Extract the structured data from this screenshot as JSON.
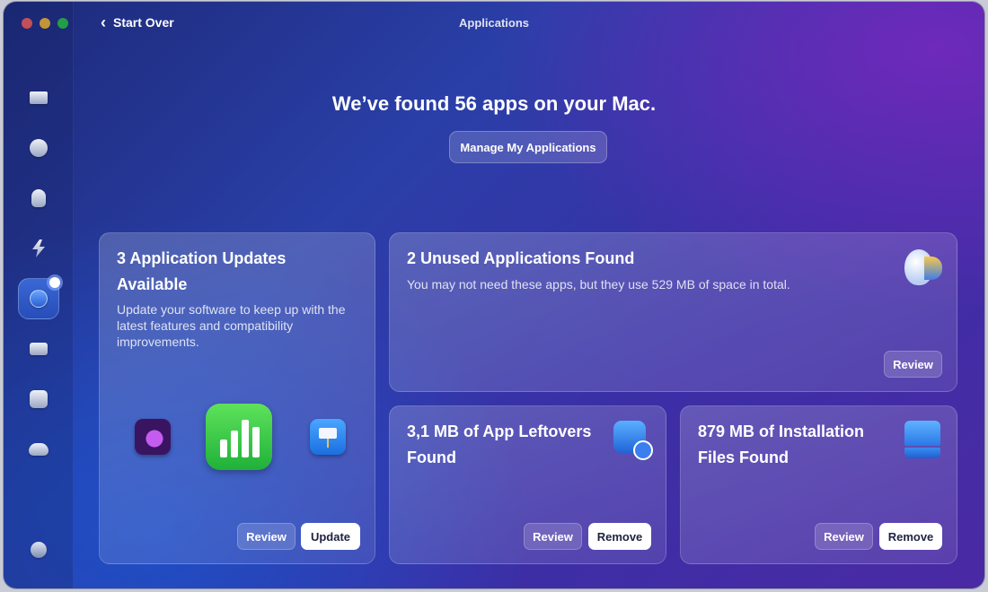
{
  "window": {
    "title": "Applications",
    "back_label": "Start Over"
  },
  "sidebar": {
    "items": [
      {
        "name": "sidebar-item-smart-care",
        "icon": "display-icon",
        "active": false
      },
      {
        "name": "sidebar-item-cleanup",
        "icon": "globe-icon",
        "active": false
      },
      {
        "name": "sidebar-item-protection",
        "icon": "hand-icon",
        "active": false
      },
      {
        "name": "sidebar-item-performance",
        "icon": "bolt-icon",
        "active": false
      },
      {
        "name": "sidebar-item-applications",
        "icon": "app-store-icon",
        "active": true
      },
      {
        "name": "sidebar-item-my-clutter",
        "icon": "folder-icon",
        "active": false
      },
      {
        "name": "sidebar-item-space-lens",
        "icon": "lens-icon",
        "active": false
      },
      {
        "name": "sidebar-item-cloud",
        "icon": "cloud-icon",
        "active": false
      }
    ],
    "account_icon": "avatar-icon"
  },
  "hero": {
    "title": "We’ve found 56 apps on your Mac.",
    "manage_button": "Manage My Applications"
  },
  "cards": {
    "updates": {
      "title": "3 Application Updates Available",
      "description": "Update your software to keep up with the latest features and compatibility improvements.",
      "review_label": "Review",
      "update_label": "Update",
      "apps": [
        "purple-app-icon",
        "numbers-app-icon",
        "keynote-app-icon"
      ]
    },
    "unused": {
      "title": "2 Unused Applications Found",
      "description": "You may not need these apps, but they use 529 MB of space in total.",
      "review_label": "Review",
      "icon": "unused-apps-icon"
    },
    "leftovers": {
      "title": "3,1 MB of App Leftovers Found",
      "review_label": "Review",
      "remove_label": "Remove",
      "icon": "leftovers-icon"
    },
    "installation": {
      "title": "879 MB of Installation Files Found",
      "review_label": "Review",
      "remove_label": "Remove",
      "icon": "disk-icon"
    }
  },
  "colors": {
    "close": "#fe5f57",
    "minimize": "#febc2e",
    "maximize": "#28c840",
    "accent": "#2a5fd1"
  }
}
